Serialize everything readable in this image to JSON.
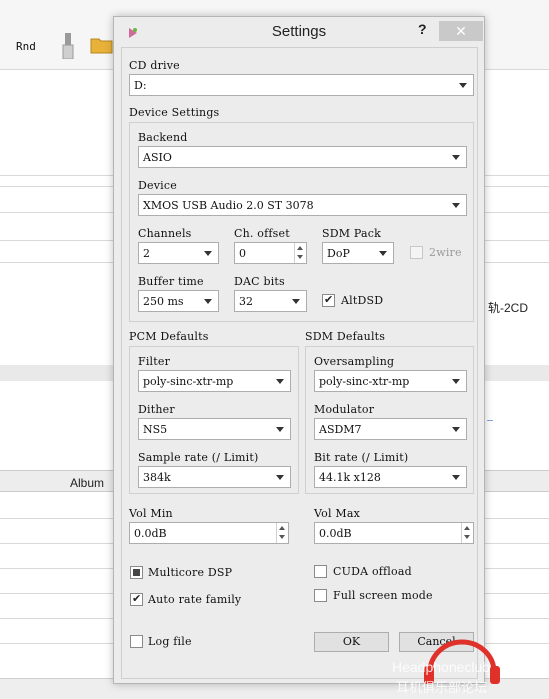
{
  "background": {
    "toolbar_rnd": "Rnd",
    "album_header": "Album",
    "row_text": "轨-2CD",
    "blue_marker": "┄"
  },
  "dialog": {
    "title": "Settings",
    "help_label": "?",
    "close_label": "✕",
    "cd_drive": {
      "label": "CD drive",
      "value": "D:"
    },
    "device_settings": {
      "label": "Device Settings",
      "backend": {
        "label": "Backend",
        "value": "ASIO"
      },
      "device": {
        "label": "Device",
        "value": "XMOS USB Audio 2.0 ST 3078"
      },
      "channels": {
        "label": "Channels",
        "value": "2"
      },
      "ch_offset": {
        "label": "Ch. offset",
        "value": "0"
      },
      "sdm_pack": {
        "label": "SDM Pack",
        "value": "DoP"
      },
      "twowire": {
        "label": "2wire",
        "checked": false,
        "enabled": false
      },
      "buffer_time": {
        "label": "Buffer time",
        "value": "250 ms"
      },
      "dac_bits": {
        "label": "DAC bits",
        "value": "32"
      },
      "altdsd": {
        "label": "AltDSD",
        "checked": true
      }
    },
    "pcm_defaults": {
      "label": "PCM Defaults",
      "filter": {
        "label": "Filter",
        "value": "poly-sinc-xtr-mp"
      },
      "dither": {
        "label": "Dither",
        "value": "NS5"
      },
      "sample_rate": {
        "label": "Sample rate (/ Limit)",
        "value": "384k"
      }
    },
    "sdm_defaults": {
      "label": "SDM Defaults",
      "oversampling": {
        "label": "Oversampling",
        "value": "poly-sinc-xtr-mp"
      },
      "modulator": {
        "label": "Modulator",
        "value": "ASDM7"
      },
      "bit_rate": {
        "label": "Bit rate (/ Limit)",
        "value": "44.1k x128"
      }
    },
    "vol_min": {
      "label": "Vol Min",
      "value": "0.0dB"
    },
    "vol_max": {
      "label": "Vol Max",
      "value": "0.0dB"
    },
    "multicore_dsp": {
      "label": "Multicore DSP",
      "state": "partial"
    },
    "cuda_offload": {
      "label": "CUDA offload",
      "checked": false
    },
    "auto_rate_family": {
      "label": "Auto rate family",
      "checked": true
    },
    "full_screen_mode": {
      "label": "Full screen mode",
      "checked": false
    },
    "log_file": {
      "label": "Log file",
      "checked": false
    },
    "ok_label": "OK",
    "cancel_label": "Cancel"
  },
  "watermark": {
    "line1": "Headphoneclub",
    "line2": "耳机俱乐部论坛"
  },
  "colors": {
    "dialog_bg": "#ececec",
    "watermark_red": "#e0302a",
    "close_bg": "#c9c9c9"
  }
}
